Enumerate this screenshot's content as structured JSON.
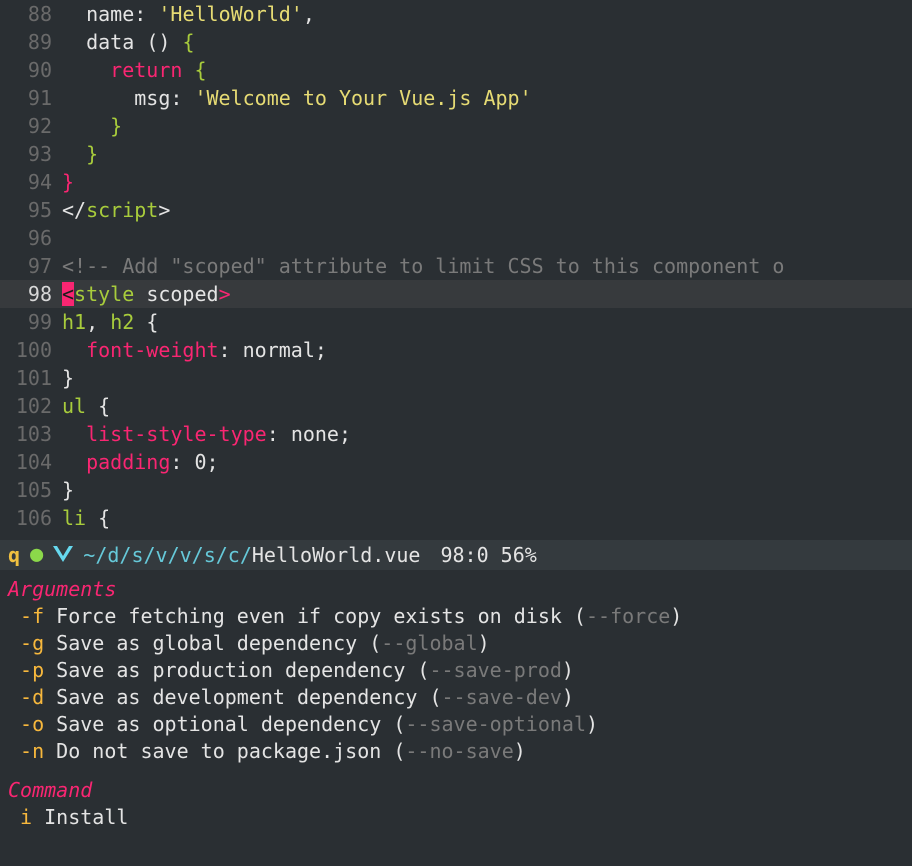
{
  "editor": {
    "lines": [
      {
        "n": 88,
        "current": false,
        "tokens": [
          {
            "t": "  ",
            "c": "c-white"
          },
          {
            "t": "name",
            "c": "c-white"
          },
          {
            "t": ": ",
            "c": "c-white"
          },
          {
            "t": "'HelloWorld'",
            "c": "c-yellow"
          },
          {
            "t": ",",
            "c": "c-white"
          }
        ]
      },
      {
        "n": 89,
        "current": false,
        "tokens": [
          {
            "t": "  ",
            "c": "c-white"
          },
          {
            "t": "data",
            "c": "c-white"
          },
          {
            "t": " ",
            "c": "c-white"
          },
          {
            "t": "()",
            "c": "c-white"
          },
          {
            "t": " ",
            "c": "c-white"
          },
          {
            "t": "{",
            "c": "c-green"
          }
        ]
      },
      {
        "n": 90,
        "current": false,
        "tokens": [
          {
            "t": "    ",
            "c": "c-white"
          },
          {
            "t": "return",
            "c": "c-pink"
          },
          {
            "t": " ",
            "c": "c-white"
          },
          {
            "t": "{",
            "c": "c-green"
          }
        ]
      },
      {
        "n": 91,
        "current": false,
        "tokens": [
          {
            "t": "      ",
            "c": "c-white"
          },
          {
            "t": "msg",
            "c": "c-white"
          },
          {
            "t": ": ",
            "c": "c-white"
          },
          {
            "t": "'Welcome to Your Vue.js App'",
            "c": "c-yellow"
          }
        ]
      },
      {
        "n": 92,
        "current": false,
        "tokens": [
          {
            "t": "    ",
            "c": "c-white"
          },
          {
            "t": "}",
            "c": "c-green"
          }
        ]
      },
      {
        "n": 93,
        "current": false,
        "tokens": [
          {
            "t": "  ",
            "c": "c-white"
          },
          {
            "t": "}",
            "c": "c-green"
          }
        ]
      },
      {
        "n": 94,
        "current": false,
        "tokens": [
          {
            "t": "}",
            "c": "c-pink"
          }
        ]
      },
      {
        "n": 95,
        "current": false,
        "tokens": [
          {
            "t": "</",
            "c": "c-white"
          },
          {
            "t": "script",
            "c": "c-green"
          },
          {
            "t": ">",
            "c": "c-white"
          }
        ]
      },
      {
        "n": 96,
        "current": false,
        "tokens": [
          {
            "t": " ",
            "c": "c-white"
          }
        ]
      },
      {
        "n": 97,
        "current": false,
        "tokens": [
          {
            "t": "<!-- Add \"scoped\" attribute to limit CSS to this component o",
            "c": "c-grey"
          }
        ]
      },
      {
        "n": 98,
        "current": true,
        "tokens": [
          {
            "t": "<",
            "c": "bg-pink"
          },
          {
            "t": "style",
            "c": "c-green"
          },
          {
            "t": " ",
            "c": "c-white"
          },
          {
            "t": "scoped",
            "c": "c-white"
          },
          {
            "t": ">",
            "c": "c-pink"
          }
        ]
      },
      {
        "n": 99,
        "current": false,
        "tokens": [
          {
            "t": "h1",
            "c": "c-green"
          },
          {
            "t": ", ",
            "c": "c-white"
          },
          {
            "t": "h2",
            "c": "c-green"
          },
          {
            "t": " ",
            "c": "c-white"
          },
          {
            "t": "{",
            "c": "c-white"
          }
        ]
      },
      {
        "n": 100,
        "current": false,
        "tokens": [
          {
            "t": "  ",
            "c": "c-white"
          },
          {
            "t": "font-weight",
            "c": "c-pink"
          },
          {
            "t": ": ",
            "c": "c-white"
          },
          {
            "t": "normal",
            "c": "c-white"
          },
          {
            "t": ";",
            "c": "c-white"
          }
        ]
      },
      {
        "n": 101,
        "current": false,
        "tokens": [
          {
            "t": "}",
            "c": "c-white"
          }
        ]
      },
      {
        "n": 102,
        "current": false,
        "tokens": [
          {
            "t": "ul",
            "c": "c-green"
          },
          {
            "t": " ",
            "c": "c-white"
          },
          {
            "t": "{",
            "c": "c-white"
          }
        ]
      },
      {
        "n": 103,
        "current": false,
        "tokens": [
          {
            "t": "  ",
            "c": "c-white"
          },
          {
            "t": "list-style-type",
            "c": "c-pink"
          },
          {
            "t": ": ",
            "c": "c-white"
          },
          {
            "t": "none",
            "c": "c-white"
          },
          {
            "t": ";",
            "c": "c-white"
          }
        ]
      },
      {
        "n": 104,
        "current": false,
        "tokens": [
          {
            "t": "  ",
            "c": "c-white"
          },
          {
            "t": "padding",
            "c": "c-pink"
          },
          {
            "t": ": ",
            "c": "c-white"
          },
          {
            "t": "0",
            "c": "c-white"
          },
          {
            "t": ";",
            "c": "c-white"
          }
        ]
      },
      {
        "n": 105,
        "current": false,
        "tokens": [
          {
            "t": "}",
            "c": "c-white"
          }
        ]
      },
      {
        "n": 106,
        "current": false,
        "tokens": [
          {
            "t": "li",
            "c": "c-green"
          },
          {
            "t": " ",
            "c": "c-white"
          },
          {
            "t": "{",
            "c": "c-white"
          }
        ]
      }
    ]
  },
  "statusbar": {
    "q": "q",
    "path_dim": "~/d/s/v/v/s/c/",
    "filename": "HelloWorld.vue",
    "position": "98:0 56%"
  },
  "panel": {
    "arguments_title": "Arguments",
    "args": [
      {
        "flag": "-f",
        "desc": "Force fetching even if copy exists on disk",
        "alt": "--force"
      },
      {
        "flag": "-g",
        "desc": "Save as global dependency",
        "alt": "--global"
      },
      {
        "flag": "-p",
        "desc": "Save as production dependency",
        "alt": "--save-prod"
      },
      {
        "flag": "-d",
        "desc": "Save as development dependency",
        "alt": "--save-dev"
      },
      {
        "flag": "-o",
        "desc": "Save as optional dependency",
        "alt": "--save-optional"
      },
      {
        "flag": "-n",
        "desc": "Do not save to package.json",
        "alt": "--no-save"
      }
    ],
    "command_title": "Command",
    "commands": [
      {
        "key": "i",
        "desc": "Install"
      }
    ]
  }
}
